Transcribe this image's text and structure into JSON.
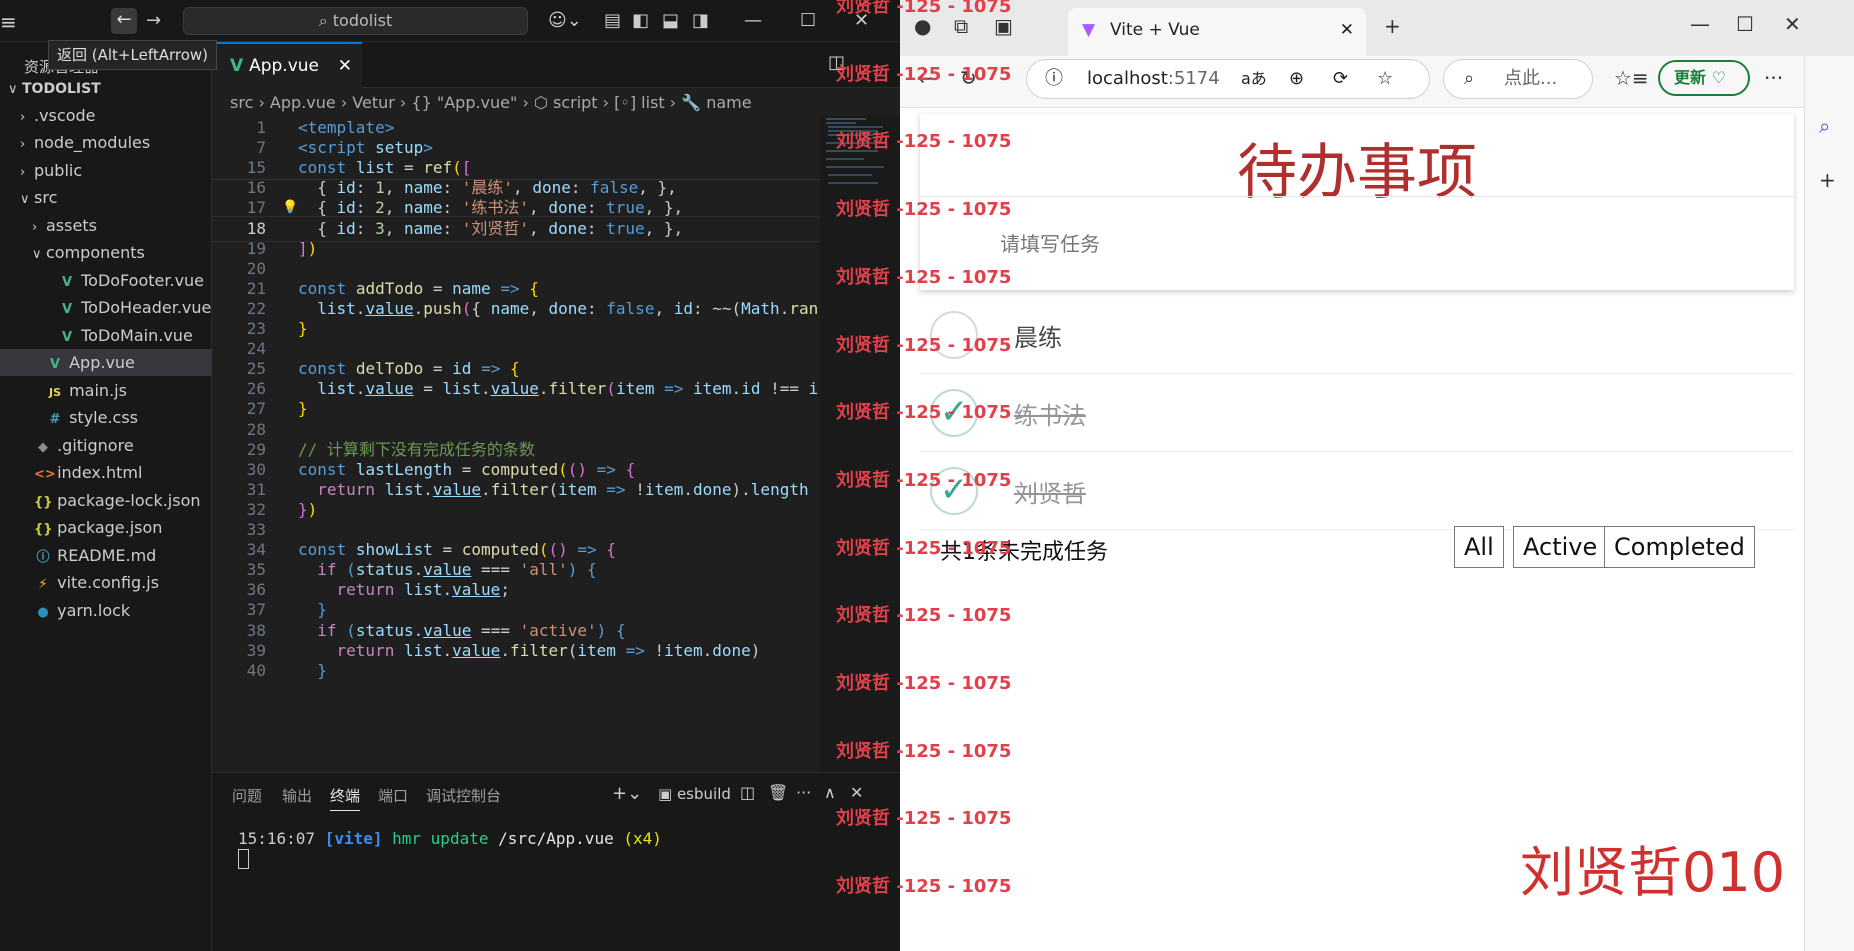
{
  "vscode": {
    "search_text": "todolist",
    "tooltip": "返回 (Alt+LeftArrow)",
    "explorer_title": "资源管理器",
    "tree": [
      {
        "label": "TODOLIST",
        "indent": 0,
        "arrow": "∨",
        "icon": "",
        "cls": ""
      },
      {
        "label": ".vscode",
        "indent": 1,
        "arrow": "›",
        "icon": "",
        "cls": ""
      },
      {
        "label": "node_modules",
        "indent": 1,
        "arrow": "›",
        "icon": "",
        "cls": ""
      },
      {
        "label": "public",
        "indent": 1,
        "arrow": "›",
        "icon": "",
        "cls": ""
      },
      {
        "label": "src",
        "indent": 1,
        "arrow": "∨",
        "icon": "",
        "cls": ""
      },
      {
        "label": "assets",
        "indent": 2,
        "arrow": "›",
        "icon": "",
        "cls": ""
      },
      {
        "label": "components",
        "indent": 2,
        "arrow": "∨",
        "icon": "",
        "cls": ""
      },
      {
        "label": "ToDoFooter.vue",
        "indent": 3,
        "arrow": "",
        "icon": "V",
        "cls": "vue"
      },
      {
        "label": "ToDoHeader.vue",
        "indent": 3,
        "arrow": "",
        "icon": "V",
        "cls": "vue"
      },
      {
        "label": "ToDoMain.vue",
        "indent": 3,
        "arrow": "",
        "icon": "V",
        "cls": "vue"
      },
      {
        "label": "App.vue",
        "indent": 2,
        "arrow": "",
        "icon": "V",
        "cls": "vue",
        "selected": true
      },
      {
        "label": "main.js",
        "indent": 2,
        "arrow": "",
        "icon": "JS",
        "cls": "js"
      },
      {
        "label": "style.css",
        "indent": 2,
        "arrow": "",
        "icon": "#",
        "cls": "css"
      },
      {
        "label": ".gitignore",
        "indent": 1,
        "arrow": "",
        "icon": "◆",
        "cls": "git"
      },
      {
        "label": "index.html",
        "indent": 1,
        "arrow": "",
        "icon": "<>",
        "cls": "html"
      },
      {
        "label": "package-lock.json",
        "indent": 1,
        "arrow": "",
        "icon": "{}",
        "cls": "json"
      },
      {
        "label": "package.json",
        "indent": 1,
        "arrow": "",
        "icon": "{}",
        "cls": "json"
      },
      {
        "label": "README.md",
        "indent": 1,
        "arrow": "",
        "icon": "ⓘ",
        "cls": "info"
      },
      {
        "label": "vite.config.js",
        "indent": 1,
        "arrow": "",
        "icon": "⚡",
        "cls": "vite"
      },
      {
        "label": "yarn.lock",
        "indent": 1,
        "arrow": "",
        "icon": "●",
        "cls": "yarn"
      }
    ],
    "tab_label": "App.vue",
    "breadcrumbs": "src  ›  App.vue  ›  Vetur  ›  {} \"App.vue\"  ›  ⬡ script  ›  [◦] list  ›  🔧 name",
    "code_lines": [
      {
        "n": "1",
        "h": "<span class='t'>&lt;template&gt;</span>",
        "sticky": true
      },
      {
        "n": "7",
        "h": "<span class='t'>&lt;script</span> <span class='v'>setup</span><span class='t'>&gt;</span>",
        "sticky": true
      },
      {
        "n": "15",
        "h": "<span class='k'>const</span> <span class='v'>list</span> = <span class='f'>ref</span><span class='y'>(</span><span class='p'>[</span>",
        "sticky": true
      },
      {
        "n": "16",
        "h": "  { <span class='v'>id</span>: <span class='n'>1</span>, <span class='v'>name</span>: <span class='s'>'晨练'</span>, <span class='v'>done</span>: <span class='k'>false</span>, },"
      },
      {
        "n": "17",
        "h": "  { <span class='v'>id</span>: <span class='n'>2</span>, <span class='v'>name</span>: <span class='s'>'练书法'</span>, <span class='v'>done</span>: <span class='k'>true</span>, },"
      },
      {
        "n": "18",
        "h": "  { <span class='v'>id</span>: <span class='n'>3</span>, <span class='v'>name</span>: <span class='s'>'刘贤哲'</span>, <span class='v'>done</span>: <span class='k'>true</span>, },",
        "cur": true
      },
      {
        "n": "19",
        "h": "<span class='p'>]</span><span class='y'>)</span>"
      },
      {
        "n": "20",
        "h": ""
      },
      {
        "n": "21",
        "h": "<span class='k'>const</span> <span class='f'>addTodo</span> = <span class='v'>name</span> <span class='k'>=&gt;</span> <span class='y'>{</span>"
      },
      {
        "n": "22",
        "h": "  <span class='v'>list</span>.<span class='v' style='text-decoration:underline'>value</span>.<span class='f'>push</span><span class='p'>(</span>{ <span class='v'>name</span>, <span class='v'>done</span>: <span class='k'>false</span>, <span class='v'>id</span>: ~~(<span class='v'>Math</span>.<span class='f'>ran</span>"
      },
      {
        "n": "23",
        "h": "<span class='y'>}</span>"
      },
      {
        "n": "24",
        "h": ""
      },
      {
        "n": "25",
        "h": "<span class='k'>const</span> <span class='f'>delToDo</span> = <span class='v'>id</span> <span class='k'>=&gt;</span> <span class='y'>{</span>"
      },
      {
        "n": "26",
        "h": "  <span class='v'>list</span>.<span class='v' style='text-decoration:underline'>value</span> = <span class='v'>list</span>.<span class='v' style='text-decoration:underline'>value</span>.<span class='f'>filter</span><span class='p'>(</span><span class='v'>item</span> <span class='k'>=&gt;</span> <span class='v'>item</span>.<span class='v'>id</span> !== <span class='v'>i</span>"
      },
      {
        "n": "27",
        "h": "<span class='y'>}</span>"
      },
      {
        "n": "28",
        "h": ""
      },
      {
        "n": "29",
        "h": "<span class='c'>// 计算剩下没有完成任务的条数</span>"
      },
      {
        "n": "30",
        "h": "<span class='k'>const</span> <span class='v'>lastLength</span> = <span class='f'>computed</span><span class='y'>(</span><span class='p'>()</span> <span class='k'>=&gt;</span> <span class='p'>{</span>"
      },
      {
        "n": "31",
        "h": "  <span class='kw'>return</span> <span class='v'>list</span>.<span class='v' style='text-decoration:underline'>value</span>.<span class='f'>filter</span>(<span class='v'>item</span> <span class='k'>=&gt;</span> !<span class='v'>item</span>.<span class='v'>done</span>).<span class='v'>length</span>"
      },
      {
        "n": "32",
        "h": "<span class='p'>}</span><span class='y'>)</span>"
      },
      {
        "n": "33",
        "h": ""
      },
      {
        "n": "34",
        "h": "<span class='k'>const</span> <span class='v'>showList</span> = <span class='f'>computed</span><span class='y'>(</span><span class='p'>()</span> <span class='k'>=&gt;</span> <span class='p'>{</span>"
      },
      {
        "n": "35",
        "h": "  <span class='kw'>if</span> <span class='k'>(</span><span class='v'>status</span>.<span class='v' style='text-decoration:underline'>value</span> === <span class='s'>'all'</span><span class='k'>)</span> <span class='k'>{</span>"
      },
      {
        "n": "36",
        "h": "    <span class='kw'>return</span> <span class='v'>list</span>.<span class='v' style='text-decoration:underline'>value</span>;"
      },
      {
        "n": "37",
        "h": "  <span class='k'>}</span>"
      },
      {
        "n": "38",
        "h": "  <span class='kw'>if</span> <span class='k'>(</span><span class='v'>status</span>.<span class='v' style='text-decoration:underline'>value</span> === <span class='s'>'active'</span><span class='k'>)</span> <span class='k'>{</span>"
      },
      {
        "n": "39",
        "h": "    <span class='kw'>return</span> <span class='v'>list</span>.<span class='v' style='text-decoration:underline'>value</span>.<span class='f'>filter</span>(<span class='v'>item</span> <span class='k'>=&gt;</span> !<span class='v'>item</span>.<span class='v'>done</span>)"
      },
      {
        "n": "40",
        "h": "  <span class='k'>}</span>"
      }
    ],
    "panel_tabs": [
      "问题",
      "输出",
      "终端",
      "端口",
      "调试控制台"
    ],
    "active_panel_tab": "终端",
    "terminal_label": "esbuild",
    "terminal_time": "15:16:07",
    "terminal_tag": "[vite]",
    "terminal_msg": "hmr update",
    "terminal_path": "/src/App.vue",
    "terminal_count": "(x4)"
  },
  "browser": {
    "tab_title": "Vite + Vue",
    "address_host": "localhost",
    "address_port": ":5174",
    "search_placeholder": "点此...",
    "update_label": "更新",
    "app": {
      "title": "待办事项",
      "input_placeholder": "请填写任务",
      "todos": [
        {
          "name": "晨练",
          "done": false
        },
        {
          "name": "练书法",
          "done": true
        },
        {
          "name": "刘贤哲",
          "done": true
        }
      ],
      "footer_text": "共1条未完成任务",
      "filters": [
        "All",
        "Active",
        "Completed"
      ]
    },
    "signature": "刘贤哲010"
  },
  "watermark": "刘贤哲 -125 - 1075"
}
